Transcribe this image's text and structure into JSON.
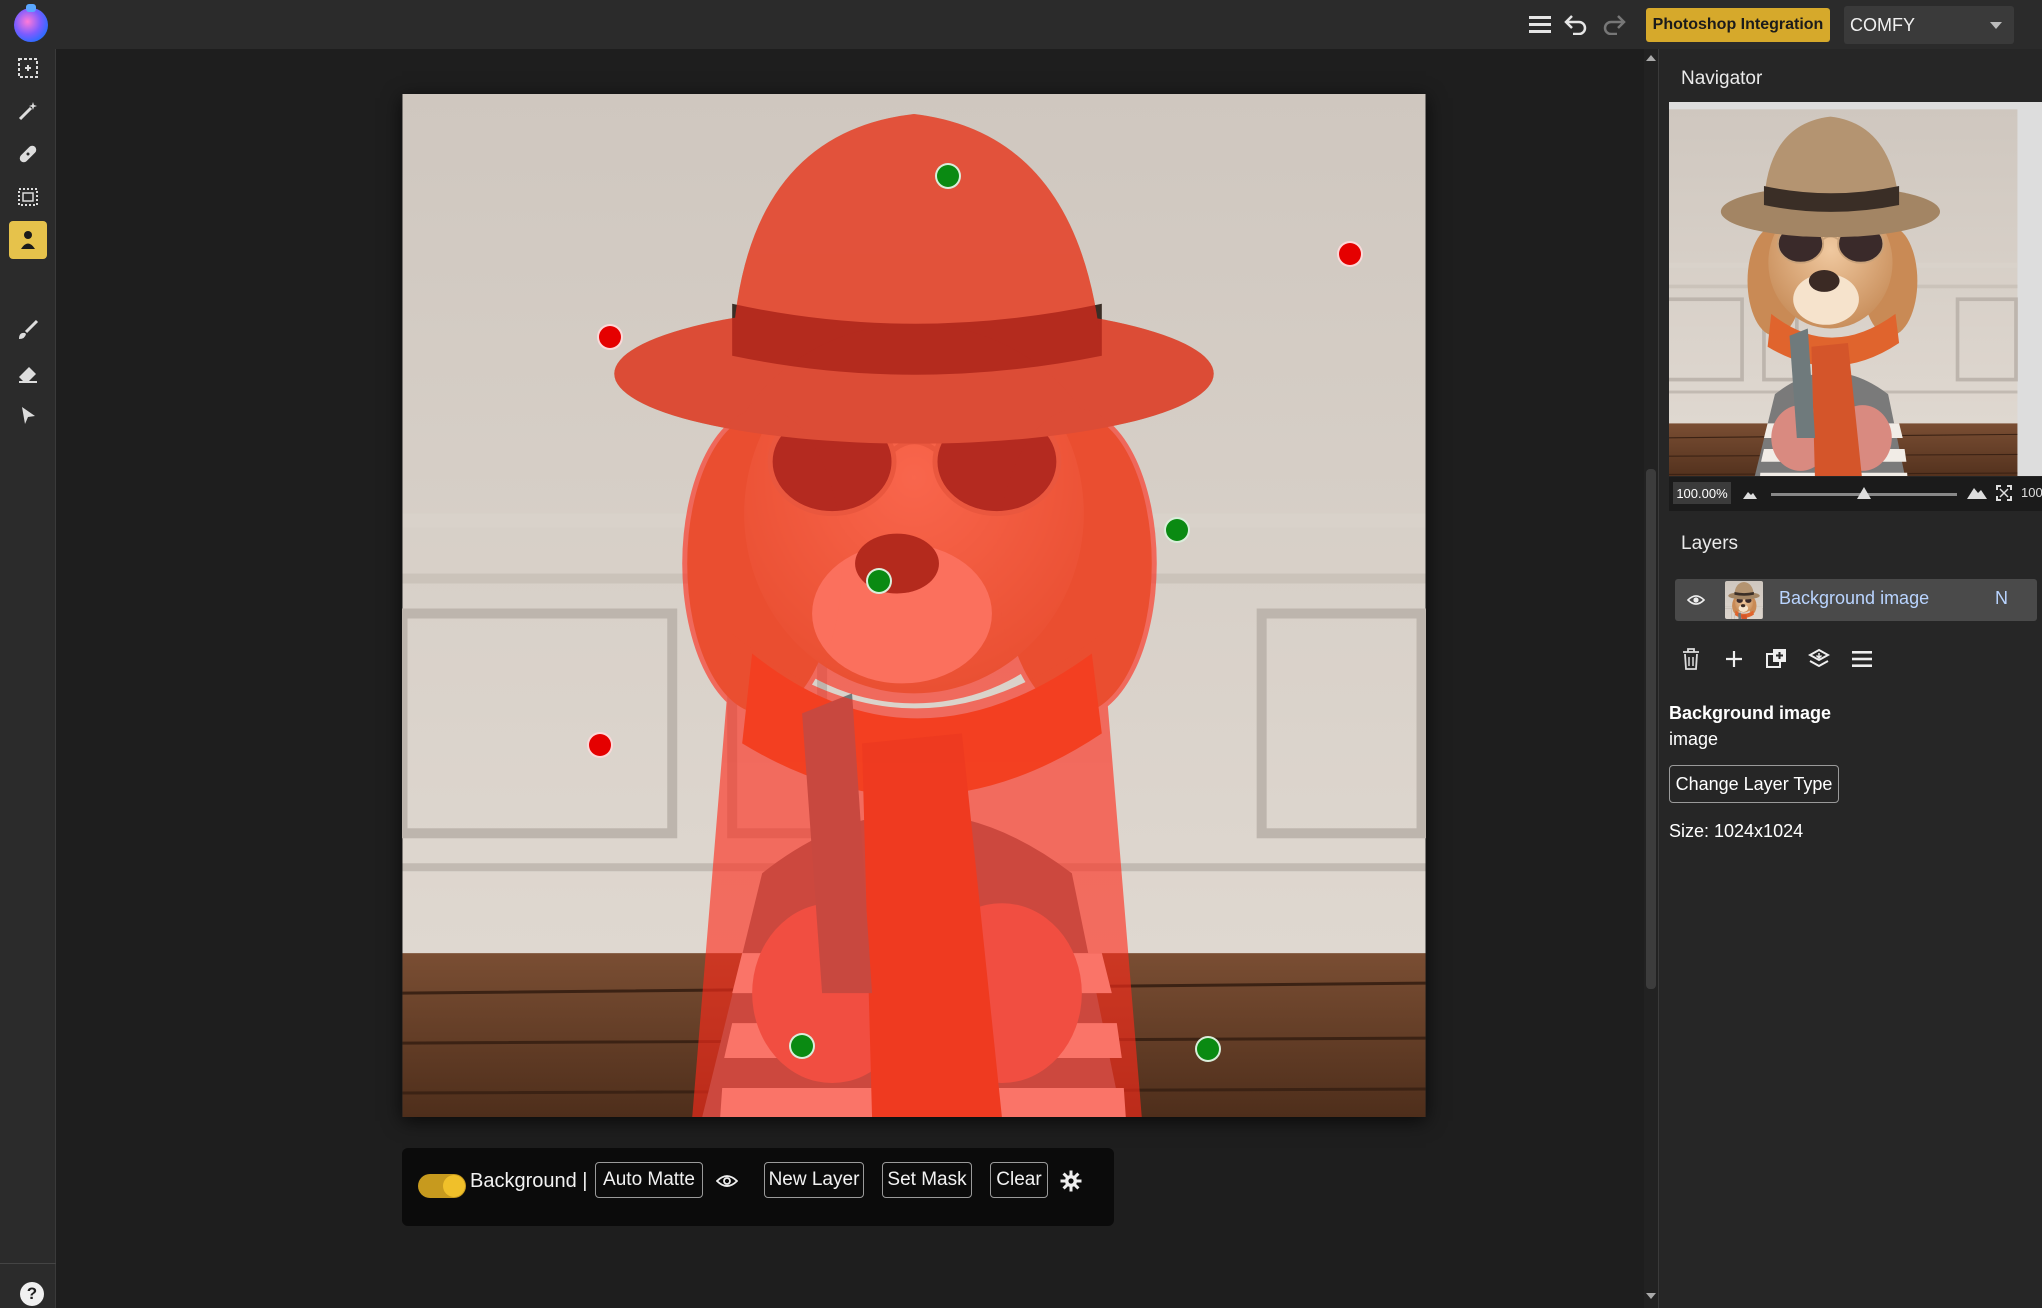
{
  "topbar": {
    "photoshop_button": "Photoshop Integration",
    "backend_select": "COMFY"
  },
  "left_tools": [
    "marquee-select",
    "magic-wand",
    "healing",
    "rect-select",
    "smart-select",
    "brush",
    "eraser",
    "pointer"
  ],
  "canvas": {
    "points": [
      {
        "type": "positive"
      },
      {
        "type": "negative"
      },
      {
        "type": "negative"
      },
      {
        "type": "positive"
      },
      {
        "type": "positive"
      },
      {
        "type": "negative"
      },
      {
        "type": "positive"
      },
      {
        "type": "positive"
      }
    ]
  },
  "bottombar": {
    "toggle_label": "Background |",
    "auto_matte": "Auto Matte",
    "new_layer": "New Layer",
    "set_mask": "Set Mask",
    "clear": "Clear"
  },
  "navigator": {
    "title": "Navigator",
    "zoom_value": "100.00%",
    "zoom_right": "100"
  },
  "layers": {
    "title": "Layers",
    "items": [
      {
        "name": "Background image",
        "mode": "N"
      }
    ]
  },
  "layer_info": {
    "title": "Background image",
    "type": "image",
    "change_type_button": "Change Layer Type",
    "size": "Size: 1024x1024"
  },
  "colors": {
    "accent": "#d6a92b",
    "positive_point": "#0a8a12",
    "negative_point": "#e50000"
  }
}
